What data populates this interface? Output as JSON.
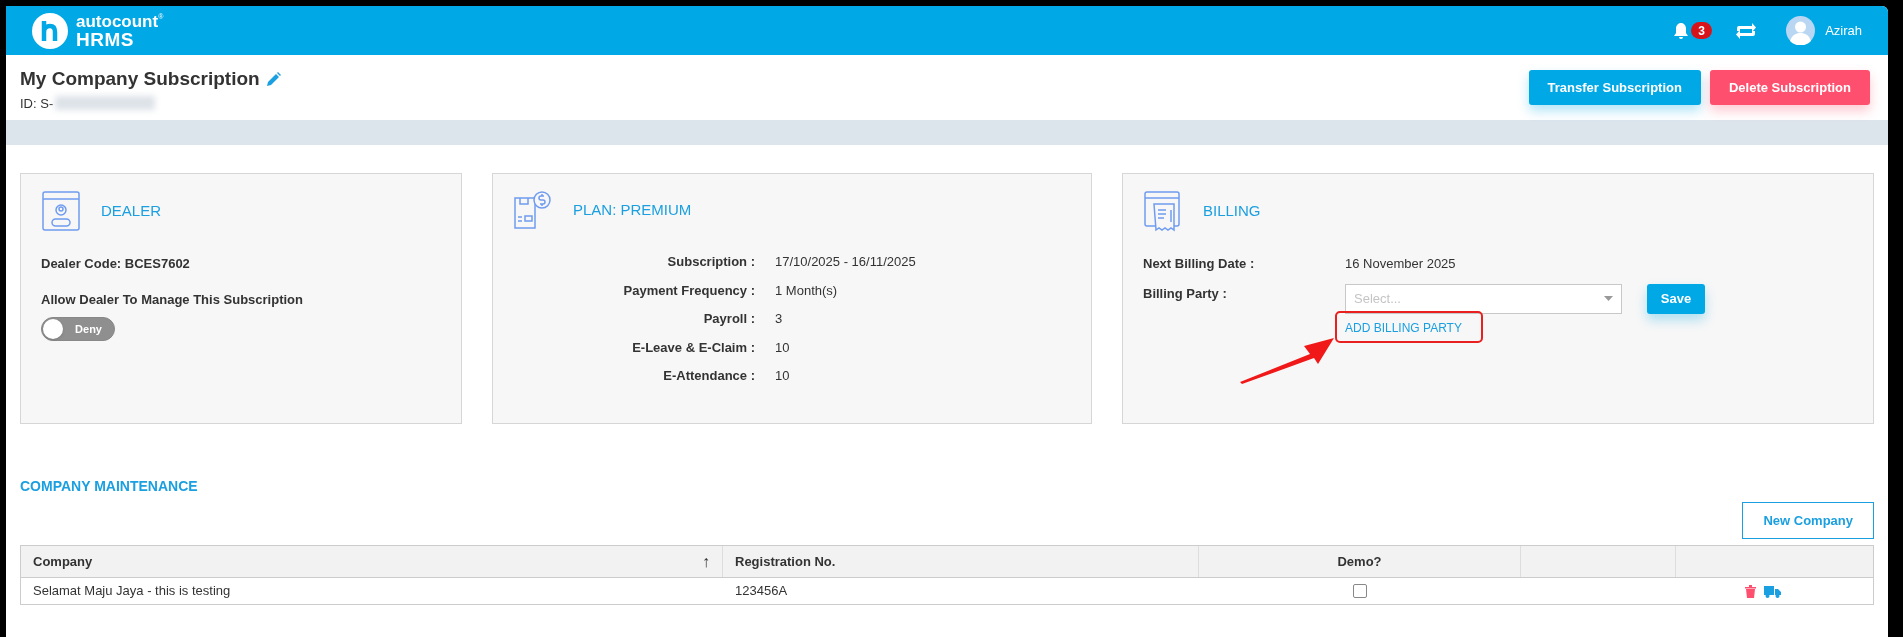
{
  "header": {
    "logo_top": "autocount",
    "logo_reg": "®",
    "logo_bottom": "HRMS",
    "notification_count": "3",
    "user": "Azirah"
  },
  "page": {
    "title": "My Company Subscription",
    "id_prefix": "ID: S-",
    "buttons": [
      {
        "label": "Transfer Subscription",
        "kind": "primary"
      },
      {
        "label": "Delete Subscription",
        "kind": "danger"
      }
    ]
  },
  "dealer": {
    "title": "DEALER",
    "code": "Dealer Code: BCES7602",
    "allow_label": "Allow Dealer To Manage This Subscription",
    "toggle": {
      "on": false,
      "label": "Deny"
    }
  },
  "plan": {
    "title": "PLAN: PREMIUM",
    "rows": [
      {
        "label": "Subscription :",
        "value": "17/10/2025 - 16/11/2025"
      },
      {
        "label": "Payment Frequency :",
        "value": "1 Month(s)"
      },
      {
        "label": "Payroll :",
        "value": "3"
      },
      {
        "label": "E-Leave & E-Claim :",
        "value": "10"
      },
      {
        "label": "E-Attendance :",
        "value": "10"
      }
    ]
  },
  "billing": {
    "title": "BILLING",
    "next_label": "Next Billing Date :",
    "next_value": "16 November 2025",
    "party_label": "Billing Party :",
    "party_placeholder": "Select...",
    "add_link": "ADD BILLING PARTY",
    "save": "Save"
  },
  "company_maintenance": {
    "title": "COMPANY MAINTENANCE",
    "new_button": "New Company",
    "sort_icon": "↑",
    "columns": [
      "Company",
      "Registration No.",
      "Demo?"
    ],
    "rows": [
      {
        "company": "Selamat Maju Jaya - this is testing",
        "registration": "123456A",
        "demo": false
      }
    ]
  }
}
